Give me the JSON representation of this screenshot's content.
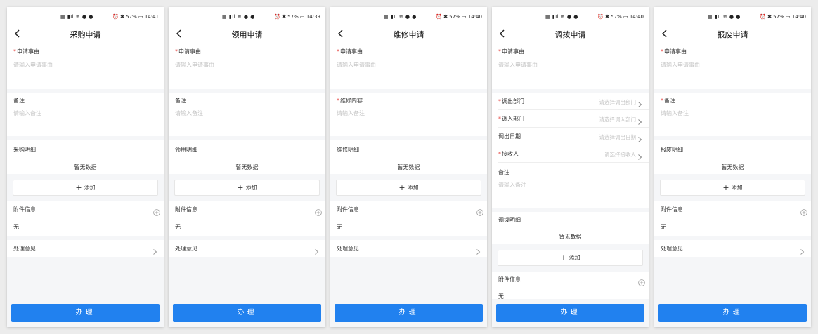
{
  "screens": [
    {
      "title": "采购申请",
      "time": "14:41",
      "battery": "57%",
      "reason_label": "申请事由",
      "reason_placeholder": "请输入申请事由",
      "second_label": "备注",
      "second_placeholder": "请输入备注",
      "detail_label": "采购明细",
      "no_data": "暂无数据",
      "add_label": "添加",
      "attach_label": "附件信息",
      "attach_value": "无",
      "opinion_label": "处理意见",
      "submit_label": "办理"
    },
    {
      "title": "领用申请",
      "time": "14:39",
      "battery": "57%",
      "reason_label": "申请事由",
      "reason_placeholder": "请输入申请事由",
      "second_label": "备注",
      "second_placeholder": "请输入备注",
      "detail_label": "领用明细",
      "no_data": "暂无数据",
      "add_label": "添加",
      "attach_label": "附件信息",
      "attach_value": "无",
      "opinion_label": "处理意见",
      "submit_label": "办理"
    },
    {
      "title": "维修申请",
      "time": "14:40",
      "battery": "57%",
      "reason_label": "申请事由",
      "reason_placeholder": "请输入申请事由",
      "second_label": "维修内容",
      "second_placeholder": "请输入备注",
      "detail_label": "维修明细",
      "no_data": "暂无数据",
      "add_label": "添加",
      "attach_label": "附件信息",
      "attach_value": "无",
      "opinion_label": "处理意见",
      "submit_label": "办理"
    },
    {
      "title": "调拨申请",
      "time": "14:40",
      "battery": "57%",
      "reason_label": "申请事由",
      "reason_placeholder": "请输入申请事由",
      "out_dept_label": "调出部门",
      "out_dept_placeholder": "请选择调出部门",
      "in_dept_label": "调入部门",
      "in_dept_placeholder": "请选择调入部门",
      "out_date_label": "调出日期",
      "out_date_placeholder": "请选择调出日期",
      "receiver_label": "接收人",
      "receiver_placeholder": "请选择接收人",
      "remark_label": "备注",
      "remark_placeholder": "请输入备注",
      "detail_label": "调拨明细",
      "no_data": "暂无数据",
      "add_label": "添加",
      "attach_label": "附件信息",
      "attach_value": "无",
      "submit_label": "办理"
    },
    {
      "title": "报废申请",
      "time": "14:40",
      "battery": "57%",
      "reason_label": "申请事由",
      "reason_placeholder": "请输入申请事由",
      "second_label": "备注",
      "second_placeholder": "请输入备注",
      "detail_label": "报废明细",
      "no_data": "暂无数据",
      "add_label": "添加",
      "attach_label": "附件信息",
      "attach_value": "无",
      "opinion_label": "处理意见",
      "submit_label": "办理"
    }
  ],
  "icons": {
    "back": "back-arrow-icon",
    "chevron": "chevron-right-icon",
    "add_circle": "add-circle-icon",
    "plus": "plus-icon"
  },
  "colors": {
    "primary": "#2181ef",
    "required": "#e53935",
    "placeholder": "#c4c4c4",
    "background": "#f5f6f8"
  }
}
